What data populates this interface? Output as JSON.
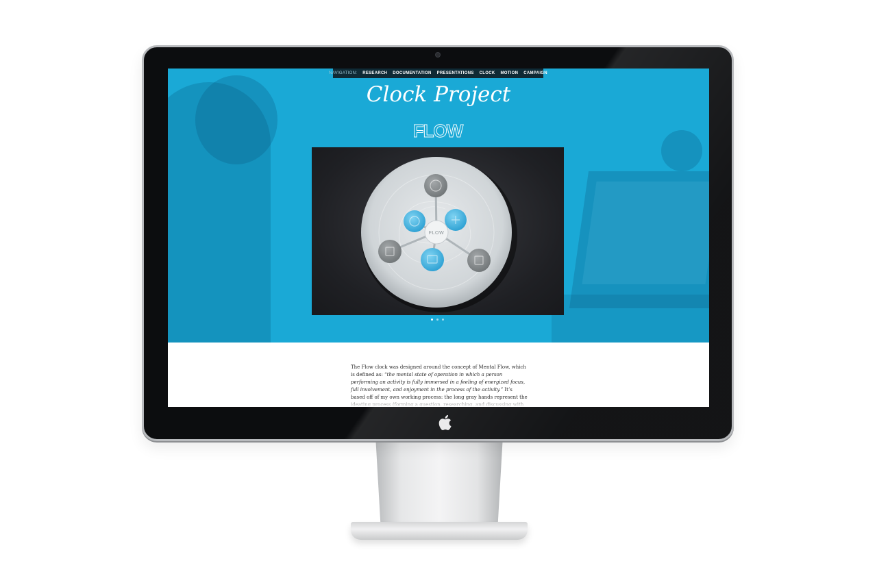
{
  "nav": {
    "label": "NAVIGATION:",
    "items": [
      "RESEARCH",
      "DOCUMENTATION",
      "PRESENTATIONS",
      "CLOCK",
      "MOTION",
      "CAMPAIGN"
    ]
  },
  "page": {
    "title": "Clock Project"
  },
  "hero": {
    "logo_text": "FLOW",
    "clock_label": "FLOW"
  },
  "carousel": {
    "slide_count": 3,
    "active_index": 0
  },
  "content": {
    "intro": "The Flow clock was designed around the concept of Mental Flow, which is defined as: ",
    "quote": "“the mental state of operation in which a person performing an activity is fully immersed in a feeling of energized focus, full involvement, and enjoyment in the process of the activity.”",
    "rest": " It’s based off of my own working process: the long gray hands represent the ideating process (forming a question, researching, and discussing with peers) while the short blue hands then represent my creating process (hand doodles, refined compositions, and digitized final products). The last setting represents the break time while the longest line represents"
  },
  "colors": {
    "hero_blue": "#1aa9d6",
    "nav_bg": "#0f2a35",
    "accent_blue": "#3aaee0"
  }
}
